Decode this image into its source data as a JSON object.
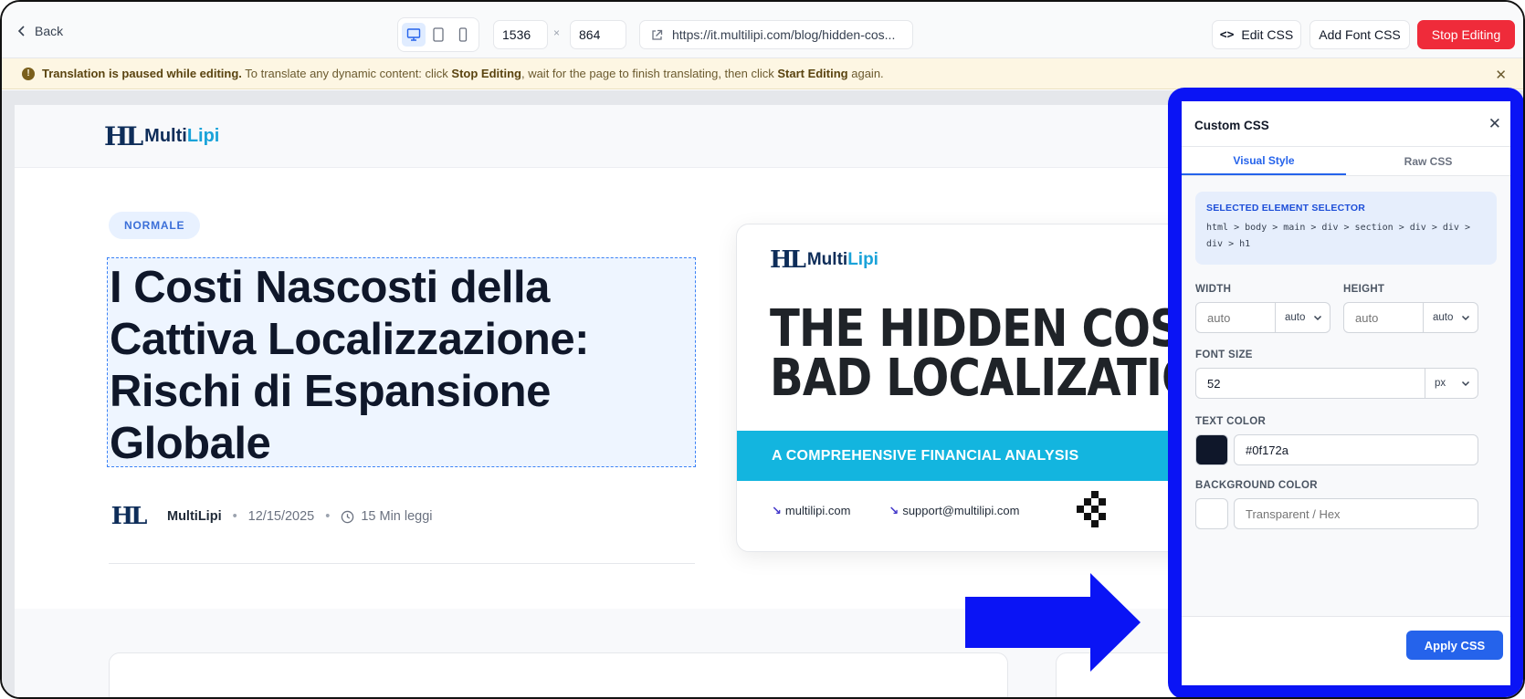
{
  "toolbar": {
    "back_label": "Back",
    "width_value": "1536",
    "height_value": "864",
    "times": "×",
    "url": "https://it.multilipi.com/blog/hidden-cos...",
    "edit_css_label": "Edit CSS",
    "add_font_css_label": "Add Font CSS",
    "stop_editing_label": "Stop Editing",
    "active_device": "desktop"
  },
  "banner": {
    "bold1": "Translation is paused while editing.",
    "text1": " To translate any dynamic content: click ",
    "bold2": "Stop Editing",
    "text2": ", wait for the page to finish translating, then click ",
    "bold3": "Start Editing",
    "text3": " again."
  },
  "site": {
    "logo_multi": "Multi",
    "logo_lipi": "Lipi",
    "badge": "NORMALE",
    "title_lines": [
      "I Costi Nascosti della",
      "Cattiva Localizzazione:",
      "Rischi di Espansione",
      "Globale"
    ],
    "author": "MultiLipi",
    "date": "12/15/2025",
    "read_time": "15 Min leggi",
    "card": {
      "title_line1": "THE HIDDEN COSTS",
      "title_line2": "BAD LOCALIZATION",
      "band": "A COMPREHENSIVE FINANCIAL ANALYSIS",
      "site": "multilipi.com",
      "email": "support@multilipi.com"
    }
  },
  "panel": {
    "title": "Custom CSS",
    "tabs": [
      "Visual Style",
      "Raw CSS"
    ],
    "selector_label": "SELECTED ELEMENT SELECTOR",
    "selector_path": "html > body > main > div > section > div > div > div > h1",
    "width_label": "WIDTH",
    "width_placeholder": "auto",
    "width_unit": "auto",
    "height_label": "HEIGHT",
    "height_placeholder": "auto",
    "height_unit": "auto",
    "font_size_label": "FONT SIZE",
    "font_size_value": "52",
    "font_size_unit": "px",
    "text_color_label": "TEXT COLOR",
    "text_color_value": "#0f172a",
    "bg_color_label": "BACKGROUND COLOR",
    "bg_color_placeholder": "Transparent / Hex",
    "apply_label": "Apply CSS"
  },
  "colors": {
    "accent": "#2563eb",
    "stop_red": "#ef2b3a",
    "annotation_blue": "#0a14f5",
    "band_cyan": "#13b5df"
  }
}
